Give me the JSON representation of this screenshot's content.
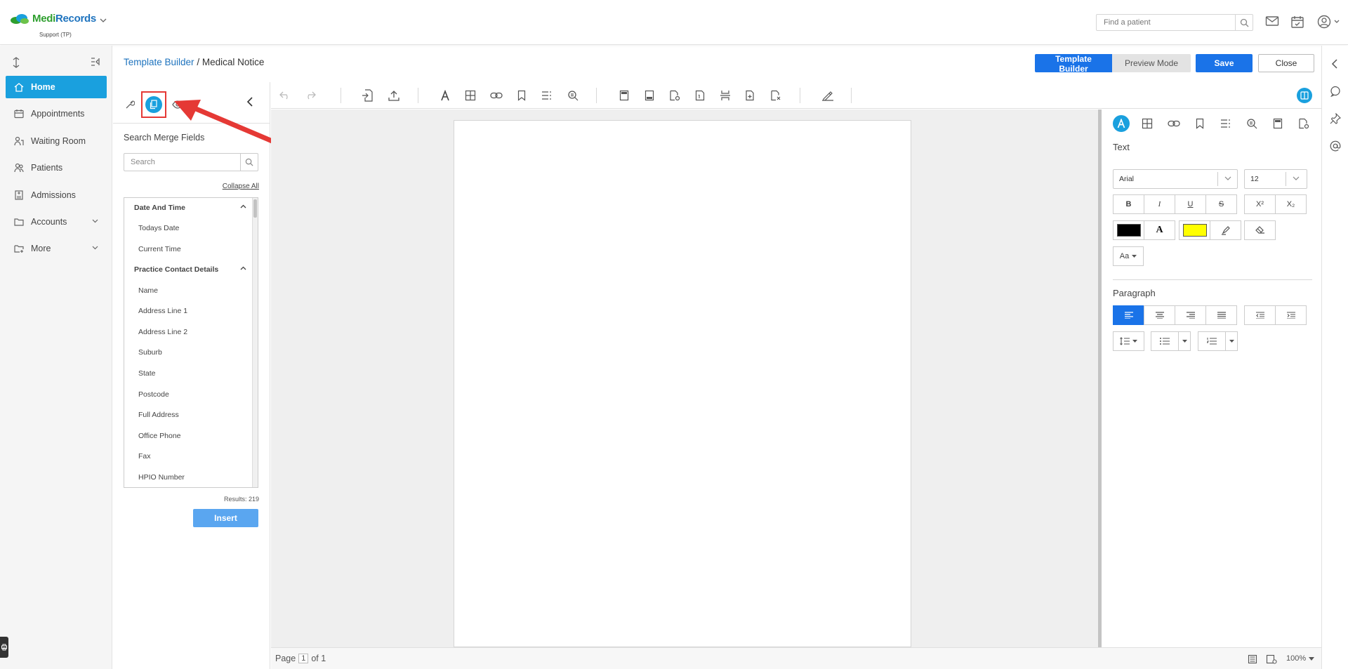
{
  "app": {
    "brand_main": "Medi",
    "brand_accent": "Records",
    "subtitle": "Support (TP)",
    "patient_search_placeholder": "Find a patient",
    "brand_green": "#2f9f2f",
    "brand_blue": "#1e73be",
    "accent": "#1aa0de"
  },
  "nav": {
    "items": [
      {
        "label": "Home",
        "icon": "home-icon",
        "active": true
      },
      {
        "label": "Appointments",
        "icon": "calendar-icon"
      },
      {
        "label": "Waiting Room",
        "icon": "waiting-room-icon"
      },
      {
        "label": "Patients",
        "icon": "patients-icon"
      },
      {
        "label": "Admissions",
        "icon": "admissions-icon"
      },
      {
        "label": "Accounts",
        "icon": "folder-icon",
        "expandable": true
      },
      {
        "label": "More",
        "icon": "more-folder-icon",
        "expandable": true
      }
    ]
  },
  "breadcrumb": {
    "root": "Template Builder",
    "separator": " / ",
    "current": "Medical Notice"
  },
  "actions": {
    "template_builder": "Template Builder",
    "preview_mode": "Preview Mode",
    "save": "Save",
    "close": "Close"
  },
  "merge_panel": {
    "tab_icons": [
      "wrench-icon",
      "merge-fields-icon",
      "eye-icon"
    ],
    "active_tab": "merge-fields-icon",
    "title": "Search Merge Fields",
    "search_placeholder": "Search",
    "collapse_all": "Collapse All",
    "groups": [
      {
        "name": "Date And Time",
        "items": [
          "Todays Date",
          "Current Time"
        ]
      },
      {
        "name": "Practice Contact Details",
        "items": [
          "Name",
          "Address Line 1",
          "Address Line 2",
          "Suburb",
          "State",
          "Postcode",
          "Full Address",
          "Office Phone",
          "Fax",
          "HPIO Number"
        ]
      }
    ],
    "results": "Results: 219",
    "insert": "Insert"
  },
  "status": {
    "page_label": "Page",
    "page_current": "1",
    "page_of": "of 1",
    "zoom": "100%"
  },
  "format_panel": {
    "text_title": "Text",
    "font": "Arial",
    "size": "12",
    "bold": "B",
    "italic": "I",
    "underline": "U",
    "strike": "S",
    "superscript": "X²",
    "subscript": "X₂",
    "font_color": "#000000",
    "font_color_letter": "A",
    "highlight_color": "#ffff00",
    "case_label": "Aa",
    "paragraph_title": "Paragraph"
  }
}
